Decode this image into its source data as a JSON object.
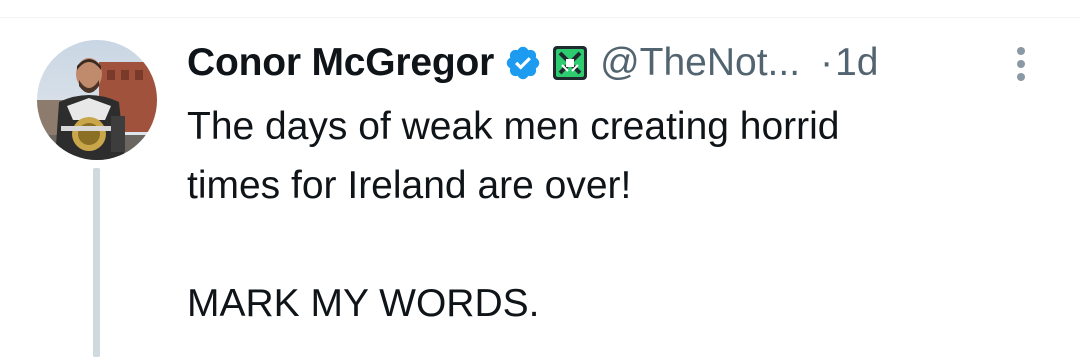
{
  "author": {
    "display_name": "Conor McGregor",
    "handle": "@TheNot...",
    "verified": true,
    "verified_color": "#1d9bf0",
    "affiliate_badge": "affiliate-badge-icon",
    "avatar_icon": "avatar-photo"
  },
  "meta": {
    "separator": "·",
    "timestamp": "1d",
    "more_icon": "more-vertical-icon"
  },
  "tweet": {
    "lines": [
      "The days of weak men creating horrid",
      "times for Ireland are over!"
    ],
    "closing": "MARK MY WORDS."
  },
  "colors": {
    "text_primary": "#0f1419",
    "text_secondary": "#536471",
    "thread_line": "#cfd9de",
    "divider": "#eff3f4"
  }
}
